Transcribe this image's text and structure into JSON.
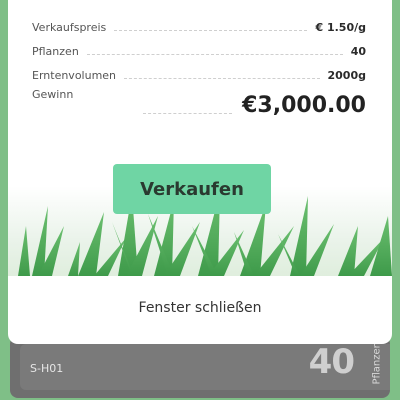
{
  "summary": {
    "rows": [
      {
        "label": "Verkaufspreis",
        "value": "€ 1.50/g"
      },
      {
        "label": "Pflanzen",
        "value": "40"
      },
      {
        "label": "Erntenvolumen",
        "value": "2000g"
      }
    ],
    "profit": {
      "label": "Gewinn",
      "value": "€3,000.00"
    }
  },
  "actions": {
    "sell_label": "Verkaufen",
    "close_label": "Fenster schließen"
  },
  "background_card": {
    "label": "S-H01",
    "count": "40",
    "count_label": "Pflanzen"
  },
  "colors": {
    "accent": "#6fd5a4",
    "frame": "#7fbf87",
    "leaf": "#4caa58"
  }
}
